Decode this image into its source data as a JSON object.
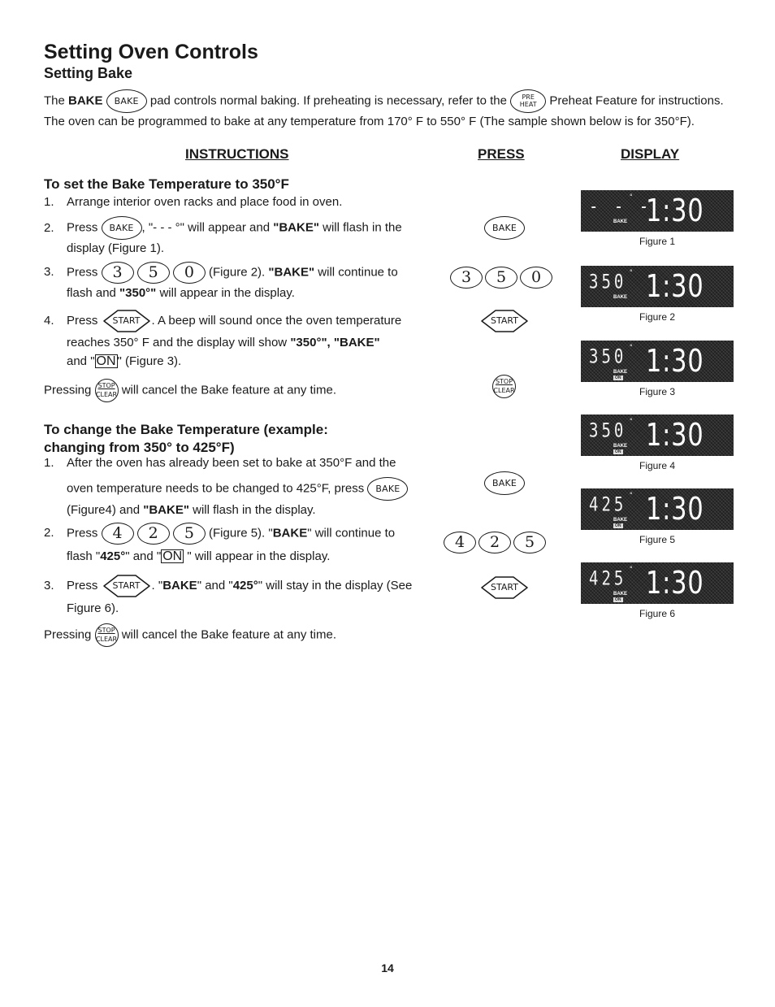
{
  "header": {
    "title": "Setting Oven Controls",
    "subtitle": "Setting Bake"
  },
  "intro": {
    "line1_pre": "The ",
    "line1_bold": "BAKE",
    "line1_mid": " pad controls normal baking. If preheating is necessary, refer to the ",
    "line1_post": " Preheat Feature for instructions.",
    "line2": "The oven can be programmed to bake at any temperature from 170° F  to 550° F (The sample shown below is for 350°F)."
  },
  "columns": {
    "instructions": "INSTRUCTIONS",
    "press": "PRESS",
    "display": "DISPLAY"
  },
  "pads": {
    "bake": "BAKE",
    "preheat_top": "PRE",
    "preheat_bottom": "HEAT",
    "start": "START",
    "stop_top": "STOP",
    "stop_bottom": "CLEAR",
    "on": "ON"
  },
  "section1": {
    "heading": "To set the Bake Temperature to 350°F",
    "steps": [
      {
        "num": "1.",
        "text": "Arrange interior oven racks and place food in oven."
      },
      {
        "num": "2.",
        "pre": "Press ",
        "post": ", \"- - - °\" will appear and ",
        "bold": "\"BAKE\"",
        "post2": " will flash in the",
        "line2": "display (Figure 1)."
      },
      {
        "num": "3.",
        "pre": "Press ",
        "keys": [
          "3",
          "5",
          "0"
        ],
        "post": " (Figure 2). ",
        "bold": "\"BAKE\"",
        "post2": " will continue to",
        "line2_pre": "flash and ",
        "line2_bold": "\"350°\"",
        "line2_post": " will appear in the display."
      },
      {
        "num": "4.",
        "pre": "Press ",
        "post": ". A beep will sound once the oven temperature",
        "line2_pre": "reaches 350° F and the display will show  ",
        "line2_bold": "\"350°\", \"BAKE\"",
        "line3_pre": "and \"",
        "line3_post": "\" (Figure 3)."
      }
    ],
    "cancel_pre": "Pressing ",
    "cancel_post": " will cancel the Bake feature at any time."
  },
  "section2": {
    "heading_line1": "To change the Bake Temperature (example:",
    "heading_line2": "changing from 350° to 425°F)",
    "steps": [
      {
        "num": "1.",
        "text": "After the oven has already been set to bake at 350°F and the",
        "line2_pre": "oven temperature needs to be changed to 425°F, press ",
        "line3_pre": "(Figure4) and ",
        "line3_bold": "\"BAKE\"",
        "line3_post": " will flash in the display."
      },
      {
        "num": "2.",
        "pre": "Press ",
        "keys": [
          "4",
          "2",
          "5"
        ],
        "post": " (Figure 5). \"",
        "bold": "BAKE",
        "post2": "\" will continue to",
        "line2_pre": "flash \"",
        "line2_bold": "425°",
        "line2_mid": "\" and \"",
        "line2_post": " \"  will appear in the display."
      },
      {
        "num": "3.",
        "pre": "Press ",
        "post": ".  \"",
        "bold": "BAKE",
        "post2": "\" and \"",
        "bold2": "425°",
        "post3": "\" will stay in the display (See",
        "line2": "Figure 6)."
      }
    ],
    "cancel_pre": "Pressing ",
    "cancel_post": " will cancel the Bake feature at any time."
  },
  "displays": [
    {
      "temp": "- - -",
      "time": "1:30",
      "bake": "BAKE",
      "on": "",
      "caption": "Figure 1"
    },
    {
      "temp": "350",
      "time": "1:30",
      "bake": "BAKE",
      "on": "",
      "caption": "Figure 2"
    },
    {
      "temp": "350",
      "time": "1:30",
      "bake": "BAKE",
      "on": "ON",
      "caption": "Figure 3"
    },
    {
      "temp": "350",
      "time": "1:30",
      "bake": "BAKE",
      "on": "ON",
      "caption": "Figure 4"
    },
    {
      "temp": "425",
      "time": "1:30",
      "bake": "BAKE",
      "on": "ON",
      "caption": "Figure 5"
    },
    {
      "temp": "425",
      "time": "1:30",
      "bake": "BAKE",
      "on": "ON",
      "caption": "Figure 6"
    }
  ],
  "display_degree": "°",
  "page_number": "14"
}
